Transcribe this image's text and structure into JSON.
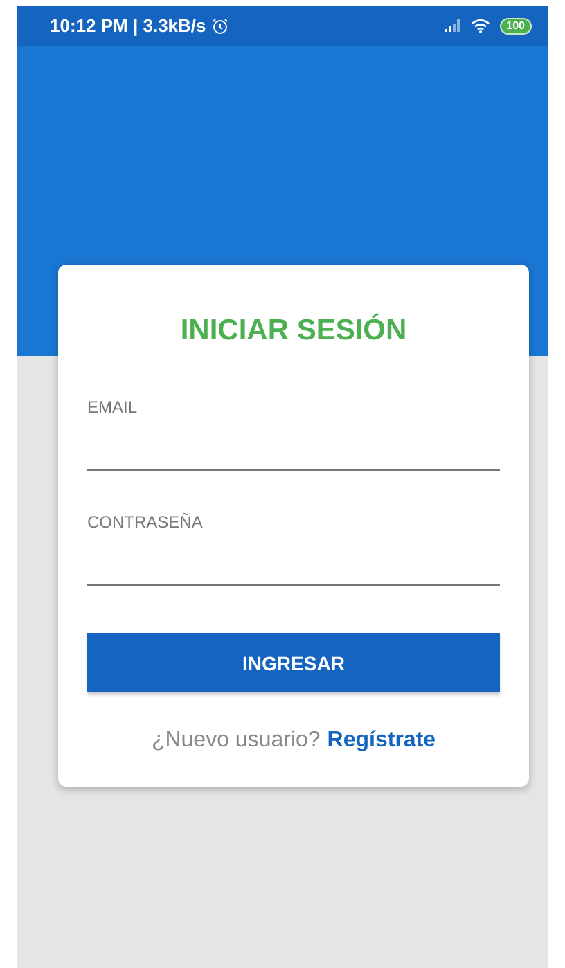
{
  "status_bar": {
    "time": "10:12 PM | 3.3kB/s",
    "battery": "100"
  },
  "login": {
    "title": "INICIAR SESIÓN",
    "fields": [
      {
        "label": "EMAIL"
      },
      {
        "label": "CONTRASEÑA"
      }
    ],
    "button": "INGRESAR",
    "signup_prompt": "¿Nuevo usuario?",
    "signup_link": "Regístrate"
  }
}
